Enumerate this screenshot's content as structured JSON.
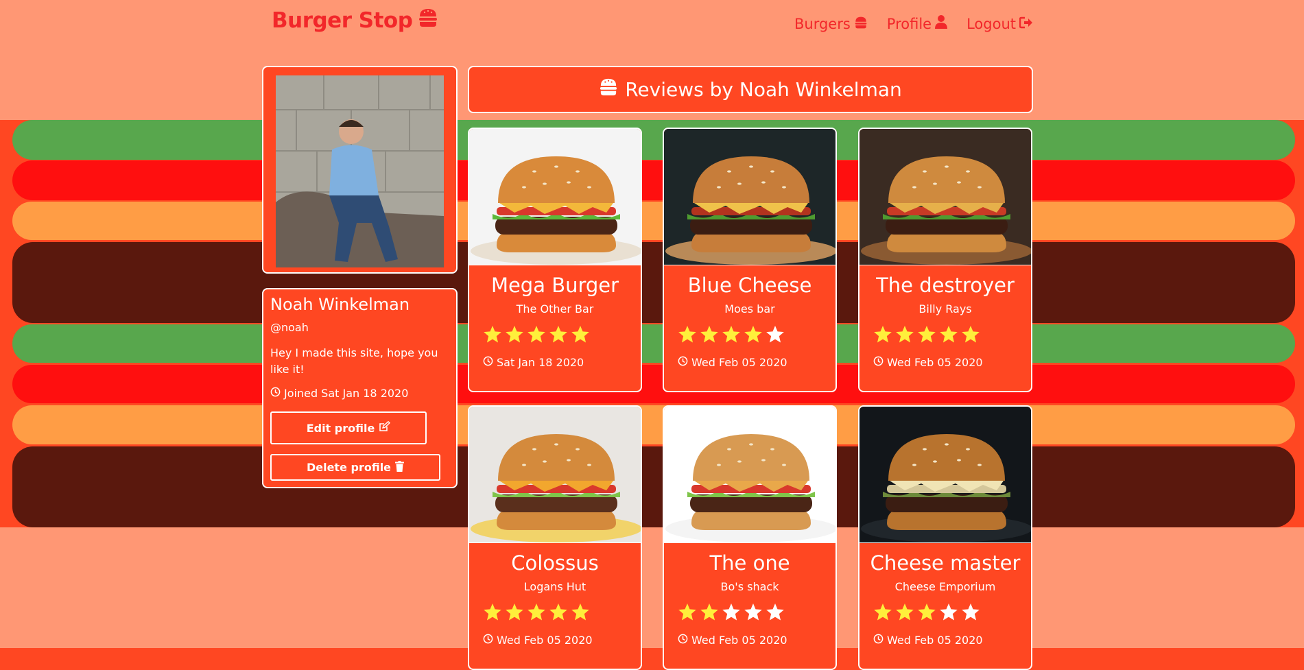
{
  "brand": {
    "title": "Burger Stop"
  },
  "nav": {
    "burgers": "Burgers",
    "profile": "Profile",
    "logout": "Logout"
  },
  "profile": {
    "name": "Noah Winkelman",
    "handle": "@noah",
    "bio": "Hey I made this site, hope you like it!",
    "joined": "Joined Sat Jan 18 2020",
    "edit_label": "Edit profile",
    "delete_label": "Delete profile"
  },
  "header": {
    "title": "Reviews by Noah Winkelman"
  },
  "reviews": [
    {
      "name": "Mega Burger",
      "place": "The Other Bar",
      "rating": 5,
      "date": "Sat Jan 18 2020"
    },
    {
      "name": "Blue Cheese",
      "place": "Moes bar",
      "rating": 4,
      "date": "Wed Feb 05 2020"
    },
    {
      "name": "The destroyer",
      "place": "Billy Rays",
      "rating": 5,
      "date": "Wed Feb 05 2020"
    },
    {
      "name": "Colossus",
      "place": "Logans Hut",
      "rating": 5,
      "date": "Wed Feb 05 2020"
    },
    {
      "name": "The one",
      "place": "Bo's shack",
      "rating": 2,
      "date": "Wed Feb 05 2020"
    },
    {
      "name": "Cheese master",
      "place": "Cheese Emporium",
      "rating": 3,
      "date": "Wed Feb 05 2020"
    }
  ],
  "colors": {
    "page_red": "#ff4722",
    "bun": "#ff9774",
    "lettuce": "#58a74d",
    "tomato": "#ff0f0f",
    "cheese": "#ff9d45",
    "patty": "#5a180d",
    "star_on": "#ffef3b",
    "star_off": "#ffffff"
  }
}
